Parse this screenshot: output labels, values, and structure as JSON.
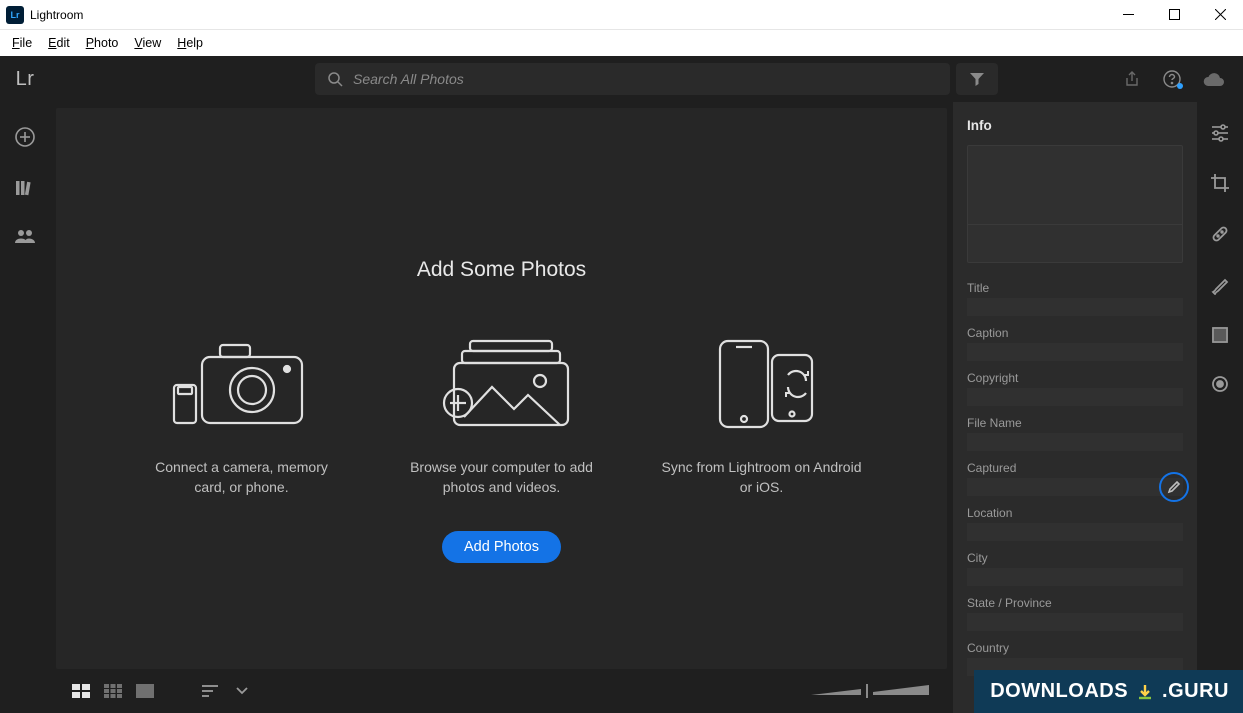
{
  "window": {
    "title": "Lightroom"
  },
  "menu": {
    "items": [
      "File",
      "Edit",
      "Photo",
      "View",
      "Help"
    ]
  },
  "topbar": {
    "logo_text": "Lr",
    "search_placeholder": "Search All Photos"
  },
  "main": {
    "heading": "Add Some Photos",
    "cards": [
      {
        "caption": "Connect a camera, memory card, or phone."
      },
      {
        "caption": "Browse your computer to add photos and videos."
      },
      {
        "caption": "Sync from Lightroom on Android or iOS."
      }
    ],
    "add_button": "Add Photos"
  },
  "info_panel": {
    "title": "Info",
    "fields": [
      "Title",
      "Caption",
      "Copyright",
      "File Name",
      "Captured",
      "Location",
      "City",
      "State / Province",
      "Country"
    ]
  },
  "watermark": {
    "left": "DOWNLOADS",
    "right": ".GURU"
  },
  "colors": {
    "accent": "#1473e6",
    "bg_dark": "#1f1f1f"
  }
}
